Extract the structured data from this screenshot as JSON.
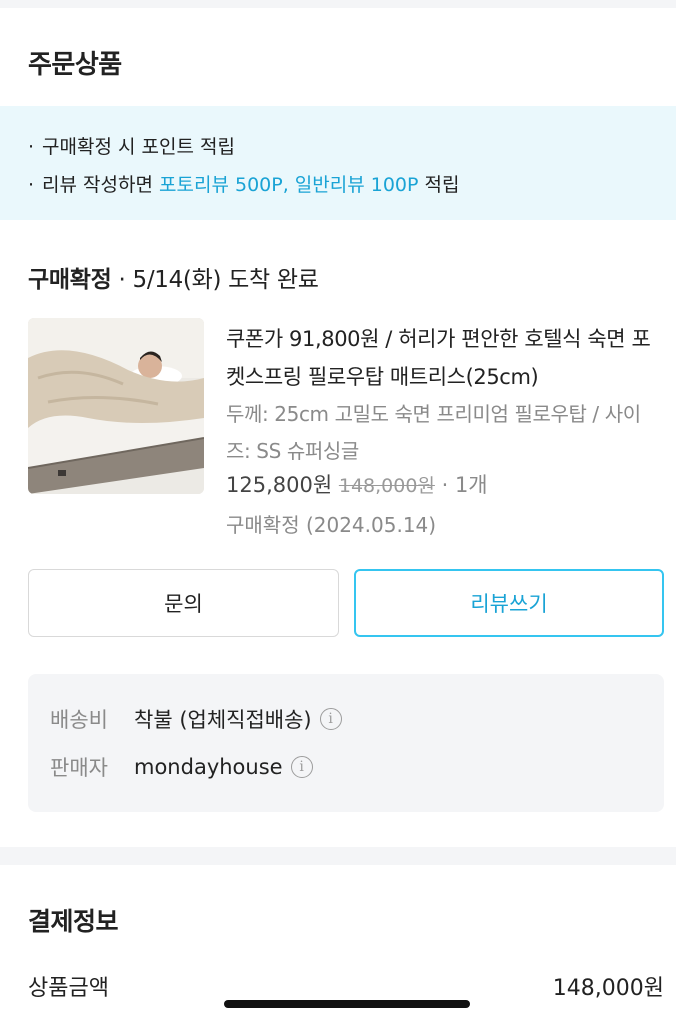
{
  "order_section": {
    "title": "주문상품"
  },
  "notice": {
    "line1": "구매확정 시 포인트 적립",
    "line2_prefix": "리뷰 작성하면 ",
    "line2_highlight": "포토리뷰 500P, 일반리뷰 100P",
    "line2_suffix": " 적립",
    "bullet": "·",
    "highlight_color": "#1aa3d5"
  },
  "status": {
    "label": "구매확정",
    "detail": " · 5/14(화) 도착 완료"
  },
  "product": {
    "name": "쿠폰가 91,800원 / 허리가 편안한 호텔식 숙면 포켓스프링 필로우탑 매트리스(25cm)",
    "option": "두께: 25cm 고밀도 숙면 프리미엄 필로우탑 / 사이즈: SS 슈퍼싱글",
    "price": "125,800원",
    "original_price": "148,000원",
    "quantity": " · 1개",
    "confirm_date": "구매확정 (2024.05.14)"
  },
  "buttons": {
    "inquiry": "문의",
    "review": "리뷰쓰기",
    "review_color": "#35c5f0"
  },
  "shipping": {
    "fee_label": "배송비",
    "fee_value": "착불 (업체직접배송)",
    "seller_label": "판매자",
    "seller_value": "mondayhouse",
    "info_icon": "info-icon"
  },
  "payment": {
    "title": "결제정보",
    "product_amount_label": "상품금액",
    "product_amount_value": "148,000원"
  }
}
